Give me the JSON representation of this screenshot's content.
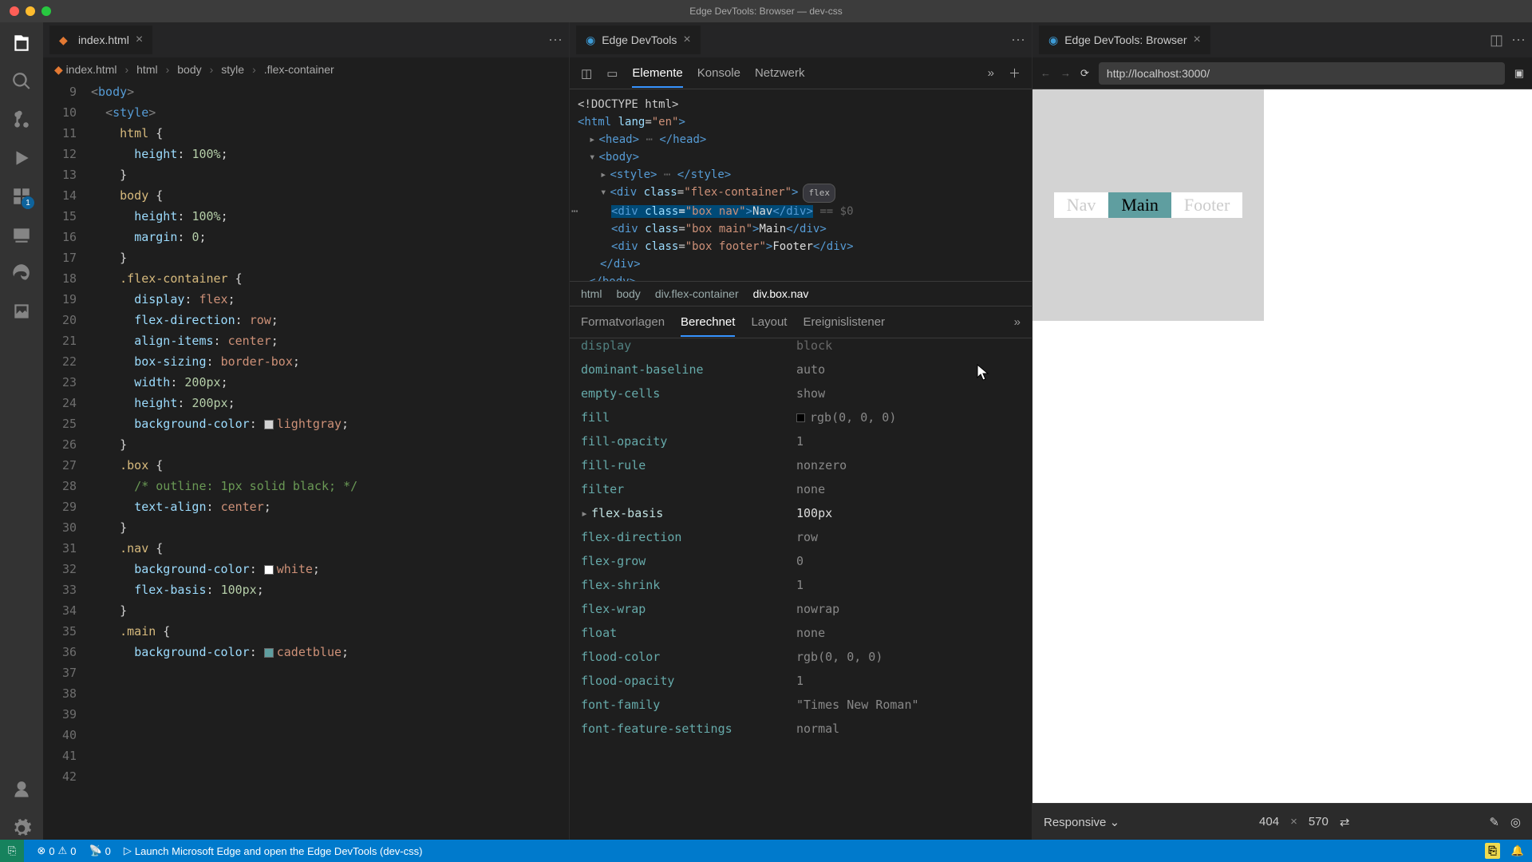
{
  "title": "Edge DevTools: Browser — dev-css",
  "pane1": {
    "tab_file": "index.html",
    "breadcrumbs": [
      "index.html",
      "html",
      "body",
      "style",
      ".flex-container"
    ],
    "startLine": 9,
    "lines": [
      [
        [
          "<",
          "p"
        ],
        [
          "body",
          "t"
        ],
        [
          ">",
          "p"
        ]
      ],
      [
        [
          "  ",
          ""
        ],
        [
          "<",
          "p"
        ],
        [
          "style",
          "t"
        ],
        [
          ">",
          "p"
        ]
      ],
      [
        [
          "    ",
          ""
        ],
        [
          "html",
          "s"
        ],
        [
          " {",
          ""
        ]
      ],
      [
        [
          "      ",
          ""
        ],
        [
          "height",
          "pr"
        ],
        [
          ": ",
          ""
        ],
        [
          "100%",
          "n"
        ],
        [
          ";",
          ""
        ]
      ],
      [
        [
          "    }",
          ""
        ]
      ],
      [
        [
          "",
          ""
        ]
      ],
      [
        [
          "    ",
          ""
        ],
        [
          "body",
          "s"
        ],
        [
          " {",
          ""
        ]
      ],
      [
        [
          "      ",
          ""
        ],
        [
          "height",
          "pr"
        ],
        [
          ": ",
          ""
        ],
        [
          "100%",
          "n"
        ],
        [
          ";",
          ""
        ]
      ],
      [
        [
          "      ",
          ""
        ],
        [
          "margin",
          "pr"
        ],
        [
          ": ",
          ""
        ],
        [
          "0",
          "n"
        ],
        [
          ";",
          ""
        ]
      ],
      [
        [
          "    }",
          ""
        ]
      ],
      [
        [
          "",
          ""
        ]
      ],
      [
        [
          "    ",
          ""
        ],
        [
          ".flex-container",
          "s"
        ],
        [
          " {",
          ""
        ]
      ],
      [
        [
          "      ",
          ""
        ],
        [
          "display",
          "pr"
        ],
        [
          ": ",
          ""
        ],
        [
          "flex",
          "v"
        ],
        [
          ";",
          ""
        ]
      ],
      [
        [
          "      ",
          ""
        ],
        [
          "flex-direction",
          "pr"
        ],
        [
          ": ",
          ""
        ],
        [
          "row",
          "v"
        ],
        [
          ";",
          ""
        ]
      ],
      [
        [
          "      ",
          ""
        ],
        [
          "align-items",
          "pr"
        ],
        [
          ": ",
          ""
        ],
        [
          "center",
          "v"
        ],
        [
          ";",
          ""
        ]
      ],
      [
        [
          "      ",
          ""
        ],
        [
          "box-sizing",
          "pr"
        ],
        [
          ": ",
          ""
        ],
        [
          "border-box",
          "v"
        ],
        [
          ";",
          ""
        ]
      ],
      [
        [
          "",
          ""
        ]
      ],
      [
        [
          "      ",
          ""
        ],
        [
          "width",
          "pr"
        ],
        [
          ": ",
          ""
        ],
        [
          "200px",
          "n"
        ],
        [
          ";",
          ""
        ]
      ],
      [
        [
          "      ",
          ""
        ],
        [
          "height",
          "pr"
        ],
        [
          ": ",
          ""
        ],
        [
          "200px",
          "n"
        ],
        [
          ";",
          ""
        ]
      ],
      [
        [
          "      ",
          ""
        ],
        [
          "background-color",
          "pr"
        ],
        [
          ": ",
          ""
        ],
        [
          "#d3d3d3",
          "sw"
        ],
        [
          "lightgray",
          "v"
        ],
        [
          ";",
          ""
        ]
      ],
      [
        [
          "    }",
          ""
        ]
      ],
      [
        [
          "",
          ""
        ]
      ],
      [
        [
          "    ",
          ""
        ],
        [
          ".box",
          "s"
        ],
        [
          " {",
          ""
        ]
      ],
      [
        [
          "      ",
          ""
        ],
        [
          "/* outline: 1px solid black; */",
          "c"
        ]
      ],
      [
        [
          "      ",
          ""
        ],
        [
          "text-align",
          "pr"
        ],
        [
          ": ",
          ""
        ],
        [
          "center",
          "v"
        ],
        [
          ";",
          ""
        ]
      ],
      [
        [
          "    }",
          ""
        ]
      ],
      [
        [
          "",
          ""
        ]
      ],
      [
        [
          "    ",
          ""
        ],
        [
          ".nav",
          "s"
        ],
        [
          " {",
          ""
        ]
      ],
      [
        [
          "      ",
          ""
        ],
        [
          "background-color",
          "pr"
        ],
        [
          ": ",
          ""
        ],
        [
          "#ffffff",
          "sw"
        ],
        [
          "white",
          "v"
        ],
        [
          ";",
          ""
        ]
      ],
      [
        [
          "      ",
          ""
        ],
        [
          "flex-basis",
          "pr"
        ],
        [
          ": ",
          ""
        ],
        [
          "100px",
          "n"
        ],
        [
          ";",
          ""
        ]
      ],
      [
        [
          "    }",
          ""
        ]
      ],
      [
        [
          "",
          ""
        ]
      ],
      [
        [
          "    ",
          ""
        ],
        [
          ".main",
          "s"
        ],
        [
          " {",
          ""
        ]
      ],
      [
        [
          "      ",
          ""
        ],
        [
          "background-color",
          "pr"
        ],
        [
          ": ",
          ""
        ],
        [
          "#5f9ea0",
          "sw"
        ],
        [
          "cadetblue",
          "v"
        ],
        [
          ";",
          ""
        ]
      ]
    ]
  },
  "pane2": {
    "tab_title": "Edge DevTools",
    "tool_tabs": [
      "Elemente",
      "Konsole",
      "Netzwerk"
    ],
    "crumbs": [
      "html",
      "body",
      "div.flex-container",
      "div.box.nav"
    ],
    "sub_tabs": [
      "Formatvorlagen",
      "Berechnet",
      "Layout",
      "Ereignislistener"
    ],
    "sub_active": 1,
    "dom": {
      "doctype": "<!DOCTYPE html>",
      "html_attr": "lang=\"en\"",
      "head": "<head> ⋯ </head>",
      "body": "<body>",
      "style": "<style> ⋯ </style>",
      "flex_open": "<div class=\"flex-container\">",
      "flex_pill": "flex",
      "nav": "<div class=\"box nav\">Nav</div>",
      "nav_dim": "== $0",
      "main": "<div class=\"box main\">Main</div>",
      "footer": "<div class=\"box footer\">Footer</div>",
      "div_close": "</div>",
      "body_close": "</body>"
    },
    "computed": [
      {
        "p": "display",
        "v": "block",
        "cut": true
      },
      {
        "p": "dominant-baseline",
        "v": "auto"
      },
      {
        "p": "empty-cells",
        "v": "show"
      },
      {
        "p": "fill",
        "v": "rgb(0, 0, 0)",
        "sw": true
      },
      {
        "p": "fill-opacity",
        "v": "1"
      },
      {
        "p": "fill-rule",
        "v": "nonzero"
      },
      {
        "p": "filter",
        "v": "none"
      },
      {
        "p": "flex-basis",
        "v": "100px",
        "strong": true,
        "exp": true
      },
      {
        "p": "flex-direction",
        "v": "row"
      },
      {
        "p": "flex-grow",
        "v": "0"
      },
      {
        "p": "flex-shrink",
        "v": "1"
      },
      {
        "p": "flex-wrap",
        "v": "nowrap"
      },
      {
        "p": "float",
        "v": "none"
      },
      {
        "p": "flood-color",
        "v": "rgb(0, 0, 0)"
      },
      {
        "p": "flood-opacity",
        "v": "1"
      },
      {
        "p": "font-family",
        "v": "\"Times New Roman\""
      },
      {
        "p": "font-feature-settings",
        "v": "normal"
      }
    ]
  },
  "pane3": {
    "tab_title": "Edge DevTools: Browser",
    "url": "http://localhost:3000/",
    "boxes": {
      "nav": "Nav",
      "main": "Main",
      "footer": "Footer"
    },
    "device": {
      "label": "Responsive",
      "w": "404",
      "h": "570"
    }
  },
  "status": {
    "errors": "0",
    "warnings": "0",
    "port": "0",
    "msg": "Launch Microsoft Edge and open the Edge DevTools (dev-css)"
  },
  "ext_badge": "1"
}
